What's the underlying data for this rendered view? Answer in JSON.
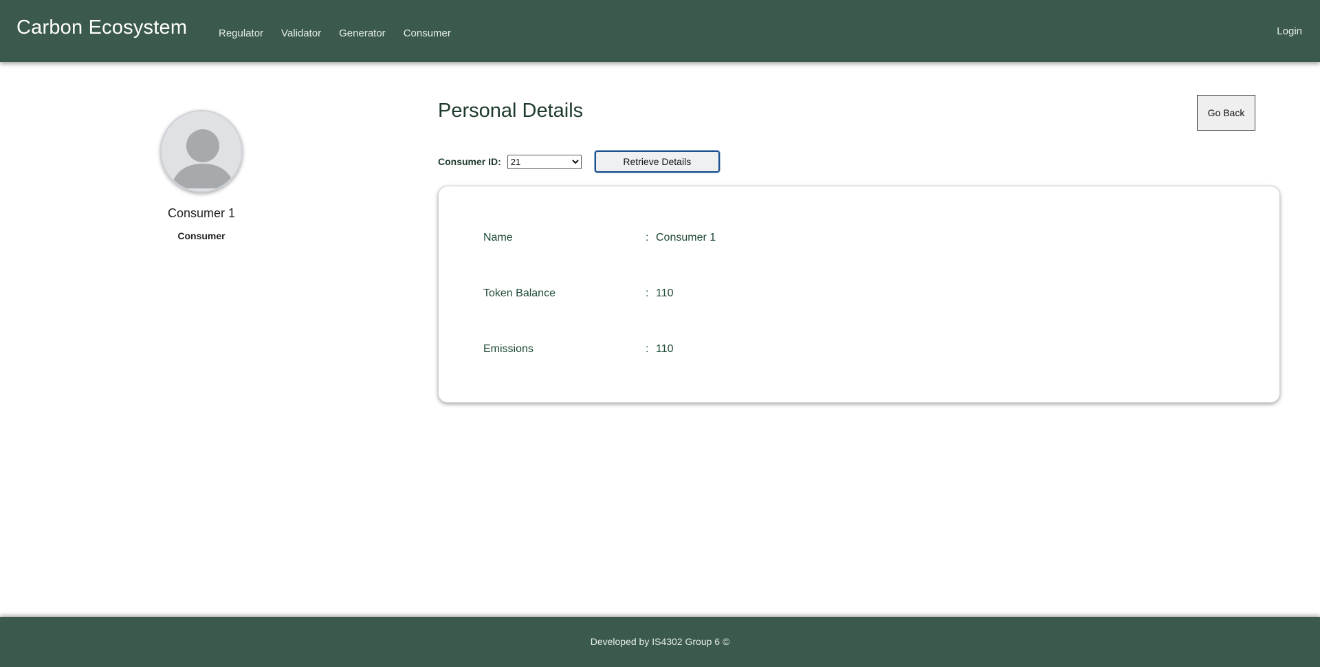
{
  "navbar": {
    "brand": "Carbon Ecosystem",
    "links": [
      "Regulator",
      "Validator",
      "Generator",
      "Consumer"
    ],
    "login": "Login"
  },
  "profile": {
    "avatar_icon": "user-avatar-icon",
    "name": "Consumer 1",
    "role": "Consumer"
  },
  "main": {
    "title": "Personal Details",
    "go_back_label": "Go Back",
    "consumer_id_label": "Consumer ID:",
    "consumer_id_value": "21",
    "retrieve_label": "Retrieve Details",
    "details": [
      {
        "label": "Name",
        "value": "Consumer 1"
      },
      {
        "label": "Token Balance",
        "value": "110"
      },
      {
        "label": "Emissions",
        "value": "110"
      }
    ],
    "separator": ":"
  },
  "footer": {
    "text": "Developed by IS4302 Group 6 ©"
  },
  "colors": {
    "header_bg": "#3b5a4b",
    "footer_bg": "#3b5a4b",
    "accent_text": "#1e3a2b",
    "button_border": "#1c4f8f"
  }
}
